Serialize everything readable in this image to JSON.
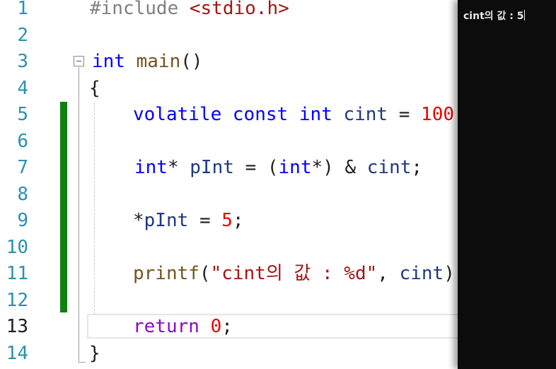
{
  "editor": {
    "line_numbers": [
      "1",
      "2",
      "3",
      "4",
      "5",
      "6",
      "7",
      "8",
      "9",
      "10",
      "11",
      "12",
      "13",
      "14"
    ],
    "current_line": "13",
    "code": {
      "l1": {
        "directive": "#include",
        "header": "<stdio.h>"
      },
      "l3": {
        "type": "int",
        "name": "main",
        "parens": "()"
      },
      "l4": {
        "brace": "{"
      },
      "l5": {
        "q1": "volatile",
        "q2": "const",
        "type": "int",
        "var": "cint",
        "eq": "=",
        "value": "100",
        "semi": ";"
      },
      "l7": {
        "type": "int",
        "star": "*",
        "var": "pInt",
        "eq": "=",
        "open": "(",
        "cast": "int",
        "cast_end": "*)",
        "amp": "&",
        "target": "cint",
        "semi": ";"
      },
      "l9": {
        "star": "*",
        "var": "pInt",
        "eq": "=",
        "value": "5",
        "semi": ";"
      },
      "l11": {
        "fn": "printf",
        "open": "(",
        "string": "\"cint의 값 : %d\"",
        "comma": ",",
        "arg": "cint",
        "close": ")"
      },
      "l13": {
        "kw": "return",
        "value": "0",
        "semi": ";"
      },
      "l14": {
        "brace": "}"
      }
    }
  },
  "console": {
    "output": "cint의 값 : 5"
  }
}
